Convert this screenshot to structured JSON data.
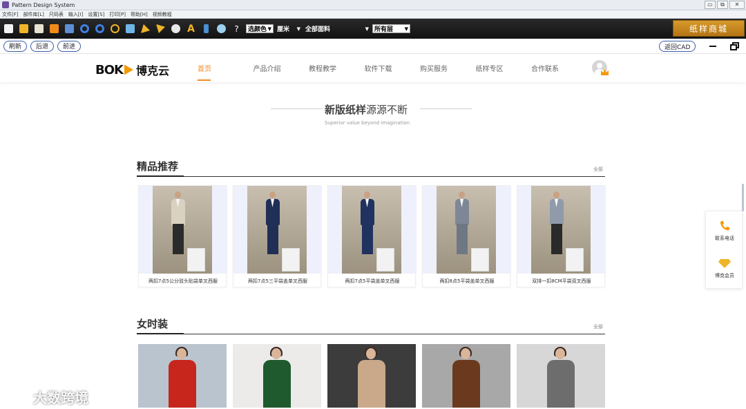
{
  "window": {
    "title": "Pattern Design System",
    "controls": [
      "▭",
      "⧉",
      "✕"
    ]
  },
  "menu": [
    "文件[F]",
    "部件库[L]",
    "尺码表",
    "输入[I]",
    "设置[S]",
    "打印[P]",
    "帮助[H]",
    "视频教程"
  ],
  "toolbar": {
    "color_select": "选颜色",
    "unit_select": "厘米",
    "fabric_select": "全部面料",
    "layer_select": "所有层",
    "shop_button": "纸样商城",
    "help_glyph": "?",
    "text_glyph": "A"
  },
  "navbar": {
    "refresh": "刷新",
    "back": "后退",
    "forward": "前进",
    "return_cad": "返回CAD"
  },
  "site": {
    "logo_latin": "BOK",
    "logo_cn": "博克云",
    "nav": [
      "首页",
      "产品介绍",
      "教程教学",
      "软件下载",
      "购买服务",
      "纸样专区",
      "合作联系"
    ],
    "accent_color": "#f08a24"
  },
  "hero": {
    "title_bold": "新版纸样",
    "title_rest": "源源不断",
    "subtitle": "Superior value beyond imagination"
  },
  "featured": {
    "title": "精品推荐",
    "all": "全部",
    "items": [
      {
        "caption": "两扣7点5公分驳头贴袋单叉西服",
        "jacket": "#d9d2c3",
        "legs": "#2b2b2b"
      },
      {
        "caption": "两扣7点5三平袋盖单叉西服",
        "jacket": "#1f2f55",
        "legs": "#1f2f55"
      },
      {
        "caption": "两扣7点5平袋盖单叉西服",
        "jacket": "#203260",
        "legs": "#203260"
      },
      {
        "caption": "两扣8点5平袋盖单叉西服",
        "jacket": "#7e8796",
        "legs": "#6f7784"
      },
      {
        "caption": "双排一扣8CM平袋双叉西服",
        "jacket": "#8f9aaa",
        "legs": "#2a2a2a"
      }
    ]
  },
  "women": {
    "title": "女时装",
    "all": "全部",
    "items": [
      {
        "bg": "#b9c4cf",
        "coat": "#c7261d"
      },
      {
        "bg": "#ecebea",
        "coat": "#1f5a2e"
      },
      {
        "bg": "#3c3c3c",
        "coat": "#c9a98a"
      },
      {
        "bg": "#a8a8a8",
        "coat": "#6b3a1e"
      },
      {
        "bg": "#d7d7d7",
        "coat": "#6d6d6d"
      }
    ]
  },
  "side": {
    "phone": "联系电话",
    "member": "博克会员"
  },
  "watermark": "大数跨境"
}
